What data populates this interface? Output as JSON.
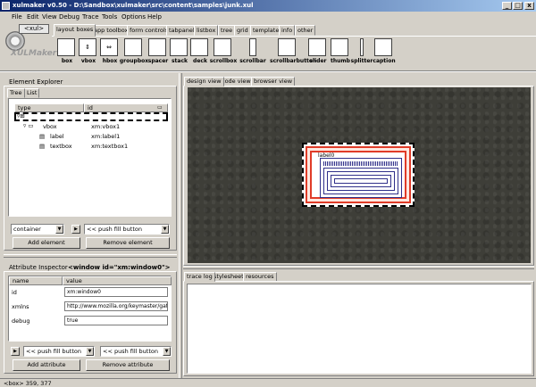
{
  "window": {
    "title": "xulmaker v0.50 - D:\\Sandbox\\xulmaker\\src\\content\\samples\\junk.xul",
    "minimize_glyph": "_",
    "maximize_glyph": "□",
    "close_glyph": "x"
  },
  "menu": [
    "File",
    "Edit",
    "View",
    "Debug",
    "Trace",
    "Tools",
    "Options",
    "Help"
  ],
  "logo": {
    "tag": "<xul>",
    "word": "XULMaker"
  },
  "palette": {
    "tabs": [
      "layout boxes",
      "app toolbox",
      "form controls",
      "tabpanel",
      "listbox",
      "tree",
      "grid",
      "template",
      "info",
      "other"
    ],
    "active_tab": "layout boxes",
    "items": [
      {
        "label": "box",
        "glyph": ""
      },
      {
        "label": "vbox",
        "glyph": "⇕"
      },
      {
        "label": "hbox",
        "glyph": "⇔"
      },
      {
        "label": "groupbox",
        "glyph": ""
      },
      {
        "label": "spacer",
        "glyph": ""
      },
      {
        "label": "stack",
        "glyph": ""
      },
      {
        "label": "deck",
        "glyph": ""
      },
      {
        "label": "scrollbox",
        "glyph": ""
      },
      {
        "label": "scrollbar",
        "glyph": ""
      },
      {
        "label": "scrollbarbutton",
        "glyph": ""
      },
      {
        "label": "slider",
        "glyph": ""
      },
      {
        "label": "thumb",
        "glyph": ""
      },
      {
        "label": "splitter",
        "glyph": ""
      },
      {
        "label": "caption",
        "glyph": ""
      }
    ]
  },
  "explorer": {
    "title": "Element Explorer",
    "tabs": [
      "Tree",
      "List"
    ],
    "columns": [
      "type",
      "id"
    ],
    "rows": [
      {
        "type": "",
        "id": ""
      },
      {
        "type": "vbox",
        "id": "xm:vbox1"
      },
      {
        "type": "label",
        "id": "xm:label1"
      },
      {
        "type": "textbox",
        "id": "xm:textbox1"
      }
    ],
    "type_select": "container",
    "fill_select": "<< push fill button",
    "add_label": "Add element",
    "remove_label": "Remove element"
  },
  "inspector": {
    "title": "Attribute Inspector",
    "element_tag": "<window  id=\"xm:window0\">",
    "columns": [
      "name",
      "value"
    ],
    "rows": [
      {
        "name": "id",
        "value": "xm:window0"
      },
      {
        "name": "xmlns",
        "value": "http://www.mozilla.org/keymaster/gatekeeper"
      },
      {
        "name": "debug",
        "value": "true"
      }
    ],
    "fill_select_1": "<< push fill button",
    "fill_select_2": "<< push fill button",
    "add_label": "Add attribute",
    "remove_label": "Remove attribute"
  },
  "design": {
    "tabs": [
      "design view",
      "code view",
      "browser view"
    ],
    "label_text": "label0"
  },
  "output": {
    "tabs": [
      "trace log",
      "stylesheet",
      "resources"
    ]
  },
  "status": "<box>  359, 377"
}
